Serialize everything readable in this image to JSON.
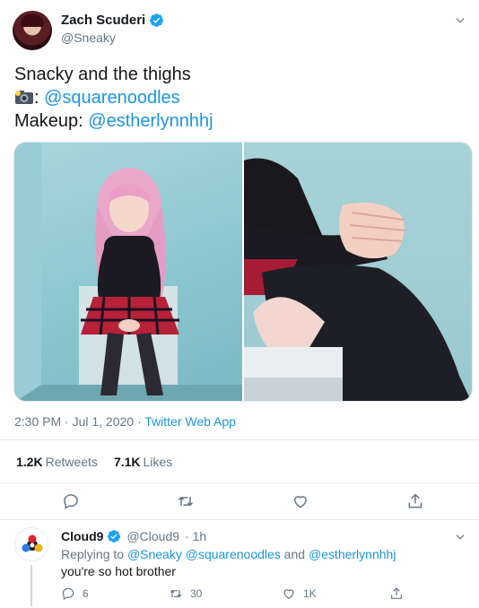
{
  "tweet": {
    "author": {
      "display_name": "Zach Scuderi",
      "handle": "@Sneaky",
      "avatar_icon": "avatar-photo",
      "verified": true
    },
    "text": {
      "line1": "Snacky and the thighs",
      "line2_prefix": ": ",
      "line2_mention": "@squarenoodles",
      "line3_prefix": "Makeup: ",
      "line3_mention": "@estherlynnhhj"
    },
    "media": [
      {
        "icon": "photo-cosplayer-seated"
      },
      {
        "icon": "photo-closeup-hands-knees"
      }
    ],
    "timestamp": "2:30 PM · Jul 1, 2020",
    "separator": " · ",
    "source": "Twitter Web App",
    "stats": {
      "retweets_count": "1.2K",
      "retweets_label": "Retweets",
      "likes_count": "7.1K",
      "likes_label": "Likes"
    }
  },
  "reply": {
    "display_name": "Cloud9",
    "handle": "@Cloud9",
    "time": "· 1h",
    "replying_prefix": "Replying to ",
    "replying_to": "@Sneaky @squarenoodles",
    "replying_and": " and ",
    "replying_last": "@estherlynnhhj",
    "text": "you're so hot brother",
    "counts": {
      "replies": "6",
      "retweets": "30",
      "likes": "1K"
    }
  },
  "colors": {
    "accent": "#1b95e0",
    "text": "#14171a",
    "muted": "#657786",
    "border": "#e6ecf0",
    "verified": "#1da1f2"
  }
}
